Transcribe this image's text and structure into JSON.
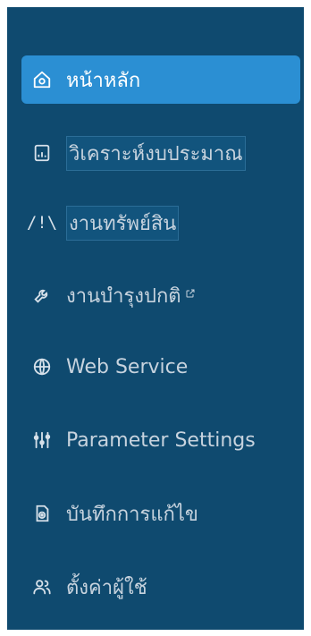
{
  "sidebar": {
    "items": [
      {
        "label": "หน้าหลัก",
        "icon": "home-icon"
      },
      {
        "label": "วิเคราะห์งบประมาณ",
        "icon": "report-icon"
      },
      {
        "label": "งานทรัพย์สิน",
        "icon": "slash-icon"
      },
      {
        "label": "งานบำรุงปกติ",
        "icon": "wrench-icon",
        "external_icon": "external-link-icon"
      },
      {
        "label": "Web Service",
        "icon": "globe-icon"
      },
      {
        "label": "Parameter Settings",
        "icon": "sliders-icon"
      },
      {
        "label": "บันทึกการแก้ไข",
        "icon": "file-edit-icon"
      },
      {
        "label": "ตั้งค่าผู้ใช้",
        "icon": "users-icon"
      }
    ],
    "slash_glyph": "/!\\",
    "active_color": "#2b8fd3",
    "background_color": "#0f4a6f"
  }
}
